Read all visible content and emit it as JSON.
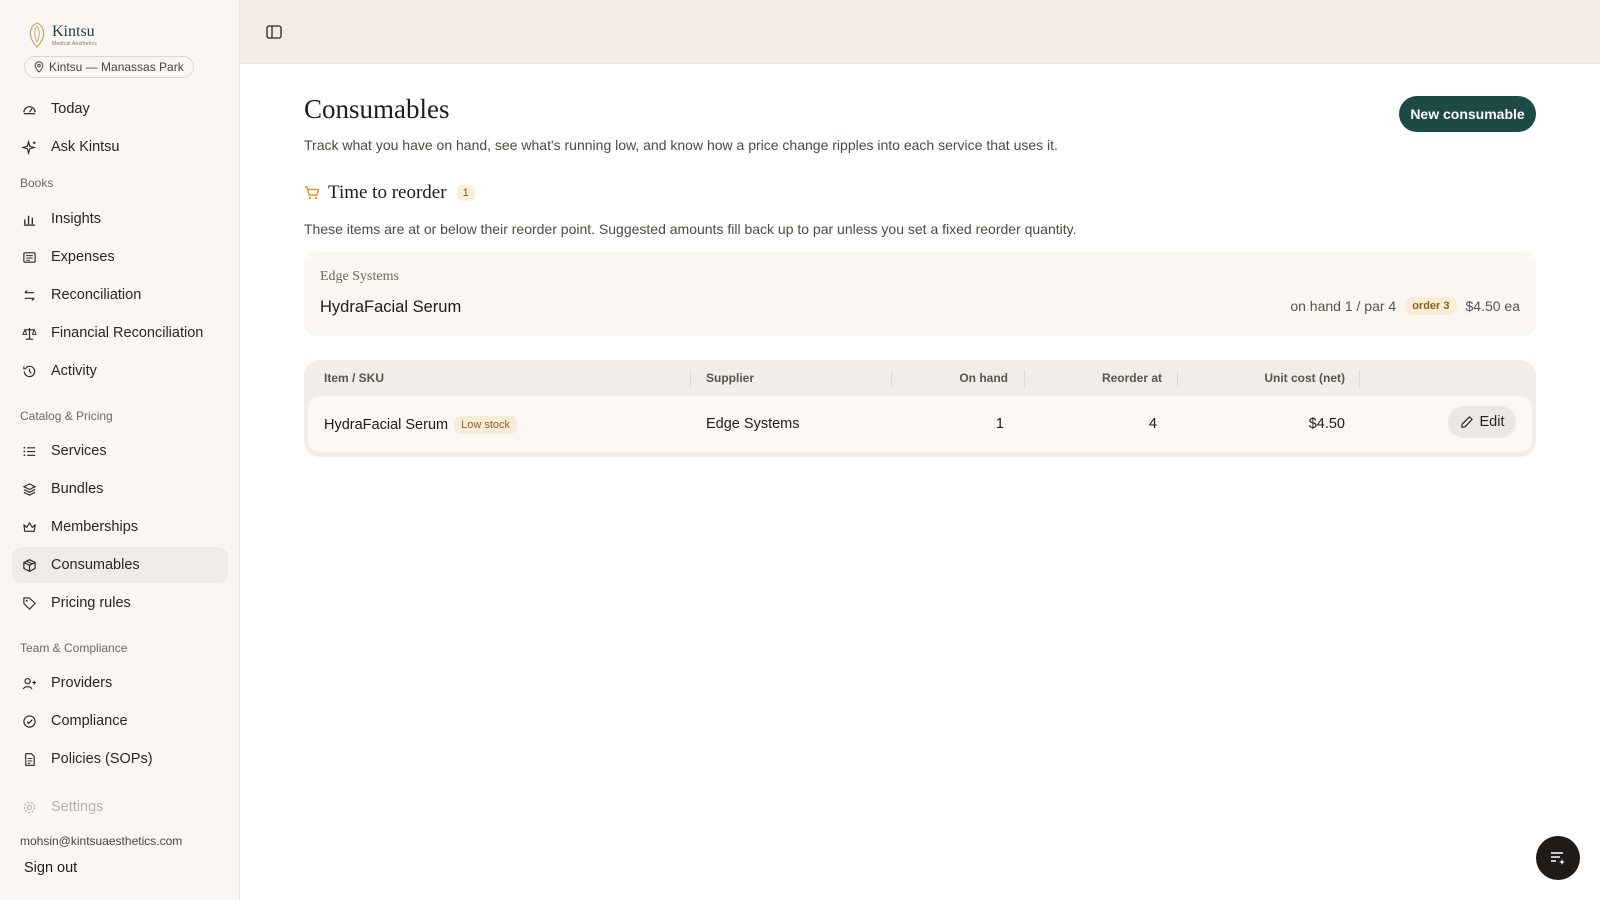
{
  "brand": {
    "name": "Kintsu",
    "tagline": "Medical Aesthetics"
  },
  "location": "Kintsu — Manassas Park",
  "sidebar": {
    "top_items": [
      {
        "label": "Today",
        "icon": "gauge-icon"
      },
      {
        "label": "Ask Kintsu",
        "icon": "sparkle-icon"
      }
    ],
    "sections": [
      {
        "title": "Books",
        "items": [
          {
            "label": "Insights",
            "icon": "bar-chart-icon"
          },
          {
            "label": "Expenses",
            "icon": "receipt-icon"
          },
          {
            "label": "Reconciliation",
            "icon": "arrows-icon"
          },
          {
            "label": "Financial Reconciliation",
            "icon": "scale-icon"
          },
          {
            "label": "Activity",
            "icon": "history-icon"
          }
        ]
      },
      {
        "title": "Catalog & Pricing",
        "items": [
          {
            "label": "Services",
            "icon": "list-icon"
          },
          {
            "label": "Bundles",
            "icon": "layers-icon"
          },
          {
            "label": "Memberships",
            "icon": "crown-icon"
          },
          {
            "label": "Consumables",
            "icon": "box-icon",
            "active": true
          },
          {
            "label": "Pricing rules",
            "icon": "tag-icon"
          }
        ]
      },
      {
        "title": "Team & Compliance",
        "items": [
          {
            "label": "Providers",
            "icon": "user-plus-icon"
          },
          {
            "label": "Compliance",
            "icon": "check-circle-icon"
          },
          {
            "label": "Policies (SOPs)",
            "icon": "document-icon"
          }
        ]
      }
    ],
    "settings_label": "Settings",
    "user_email": "mohsin@kintsuaesthetics.com",
    "sign_out": "Sign out"
  },
  "page": {
    "title": "Consumables",
    "subtitle": "Track what you have on hand, see what's running low, and know how a price change ripples into each service that uses it.",
    "new_button": "New consumable"
  },
  "reorder": {
    "title": "Time to reorder",
    "count": "1",
    "description": "These items are at or below their reorder point. Suggested amounts fill back up to par unless you set a fixed reorder quantity.",
    "card": {
      "supplier": "Edge Systems",
      "item": "HydraFacial Serum",
      "stock_text": "on hand 1 / par 4",
      "order_badge": "order 3",
      "unit_price": "$4.50 ea"
    }
  },
  "table": {
    "headers": {
      "item": "Item / SKU",
      "supplier": "Supplier",
      "on_hand": "On hand",
      "reorder_at": "Reorder at",
      "unit_cost": "Unit cost (net)"
    },
    "rows": [
      {
        "item": "HydraFacial Serum",
        "badge": "Low stock",
        "supplier": "Edge Systems",
        "on_hand": "1",
        "reorder_at": "4",
        "unit_cost": "$4.50",
        "action": "Edit"
      }
    ]
  },
  "colors": {
    "accent": "#1d4a46",
    "topbar": "#f5ebe3",
    "warning_badge": "#fbeed7",
    "sidebar_bg": "#f9f6f3"
  }
}
